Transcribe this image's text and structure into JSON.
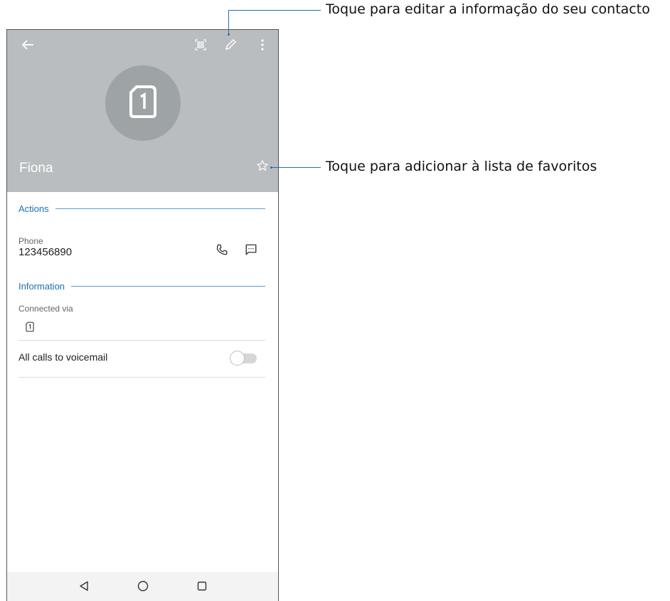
{
  "header": {
    "back_icon": "arrow-left-icon",
    "qr_icon": "qr-code-icon",
    "edit_icon": "pencil-icon",
    "more_icon": "more-vertical-icon",
    "avatar_icon": "sim-card-1-icon",
    "contact_name": "Fiona",
    "favorite_icon": "star-outline-icon"
  },
  "actions": {
    "section_label": "Actions",
    "phone_label": "Phone",
    "phone_number": "123456890",
    "call_icon": "phone-icon",
    "message_icon": "message-icon"
  },
  "information": {
    "section_label": "Information",
    "connected_via_label": "Connected via",
    "sim_icon": "sim-card-1-icon",
    "voicemail_label": "All calls to voicemail",
    "voicemail_enabled": false
  },
  "navbar": {
    "back_icon": "nav-back-triangle-icon",
    "home_icon": "nav-home-circle-icon",
    "recents_icon": "nav-recents-square-icon"
  },
  "annotations": {
    "edit_callout": "Toque para editar a informação do seu contacto",
    "favorite_callout": "Toque para adicionar à lista de favoritos"
  },
  "colors": {
    "header_bg": "#b9bdbf",
    "avatar_bg": "#9ea3a6",
    "accent": "#1f6fb5"
  }
}
